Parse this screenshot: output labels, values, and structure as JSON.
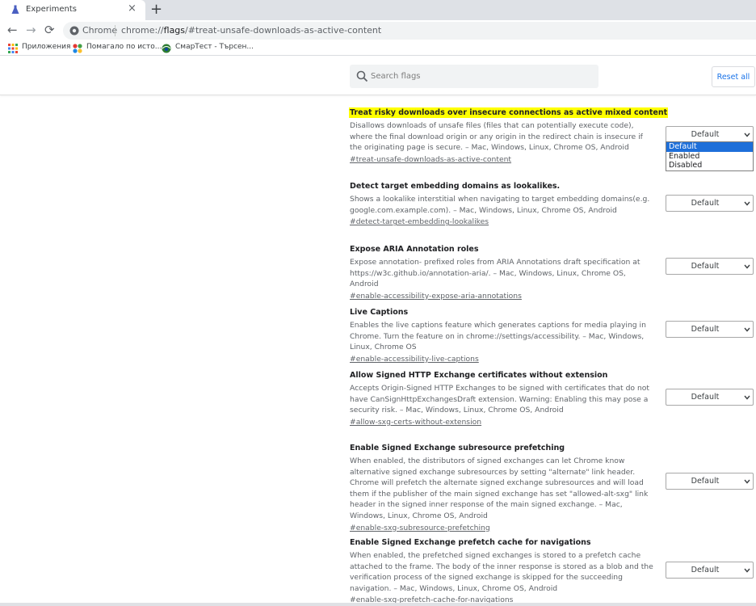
{
  "browser": {
    "tab_title": "Experiments",
    "tab_close": "×",
    "new_tab": "+",
    "back": "←",
    "forward": "→",
    "reload": "⟳",
    "omnibox_chip": "Chrome",
    "url_scheme": "chrome://",
    "url_host": "flags",
    "url_rest": "/#treat-unsafe-downloads-as-active-content",
    "bookmarks": [
      {
        "label": "Приложения",
        "icon": "apps-grid-icon"
      },
      {
        "label": "Помагало по исто...",
        "icon": "puzzle-favicon-icon"
      },
      {
        "label": "СмарТест - Търсен...",
        "icon": "globe-favicon-icon"
      }
    ]
  },
  "header": {
    "search_placeholder": "Search flags",
    "reset_label": "Reset all"
  },
  "colors": {
    "highlight": "#ffff00",
    "accent": "#1a73e8",
    "selected_option": "#1e6fd9"
  },
  "flags": [
    {
      "title": "Treat risky downloads over insecure connections as active mixed content",
      "highlighted": true,
      "desc": "Disallows downloads of unsafe files (files that can potentially execute code), where the final download origin or any origin in the redirect chain is insecure if the originating page is secure. – Mac, Windows, Linux, Chrome OS, Android",
      "link": "#treat-unsafe-downloads-as-active-content",
      "value": "Default"
    },
    {
      "title": "Detect target embedding domains as lookalikes.",
      "desc": "Shows a lookalike interstitial when navigating to target embedding domains(e.g. google.com.example.com). – Mac, Windows, Linux, Chrome OS, Android",
      "link": "#detect-target-embedding-lookalikes",
      "value": "Default"
    },
    {
      "title": "Expose ARIA Annotation roles",
      "desc": "Expose annotation- prefixed roles from ARIA Annotations draft specification at https://w3c.github.io/annotation-aria/. – Mac, Windows, Linux, Chrome OS, Android",
      "link": "#enable-accessibility-expose-aria-annotations",
      "value": "Default"
    },
    {
      "title": "Live Captions",
      "desc": "Enables the live captions feature which generates captions for media playing in Chrome. Turn the feature on in chrome://settings/accessibility. – Mac, Windows, Linux, Chrome OS",
      "link": "#enable-accessibility-live-captions",
      "value": "Default"
    },
    {
      "title": "Allow Signed HTTP Exchange certificates without extension",
      "desc": "Accepts Origin-Signed HTTP Exchanges to be signed with certificates that do not have CanSignHttpExchangesDraft extension. Warning: Enabling this may pose a security risk. – Mac, Windows, Linux, Chrome OS, Android",
      "link": "#allow-sxg-certs-without-extension",
      "value": "Default"
    },
    {
      "title": "Enable Signed Exchange subresource prefetching",
      "desc": "When enabled, the distributors of signed exchanges can let Chrome know alternative signed exchange subresources by setting \"alternate\" link header. Chrome will prefetch the alternate signed exchange subresources and will load them if the publisher of the main signed exchange has set \"allowed-alt-sxg\" link header in the signed inner response of the main signed exchange. – Mac, Windows, Linux, Chrome OS, Android",
      "link": "#enable-sxg-subresource-prefetching",
      "value": "Default"
    },
    {
      "title": "Enable Signed Exchange prefetch cache for navigations",
      "desc": "When enabled, the prefetched signed exchanges is stored to a prefetch cache attached to the frame. The body of the inner response is stored as a blob and the verification process of the signed exchange is skipped for the succeeding navigation. – Mac, Windows, Linux, Chrome OS, Android",
      "link": "#enable-sxg-prefetch-cache-for-navigations",
      "value": "Default"
    }
  ],
  "dropdown_options": [
    "Default",
    "Enabled",
    "Disabled"
  ],
  "dropdown_selected": "Default"
}
